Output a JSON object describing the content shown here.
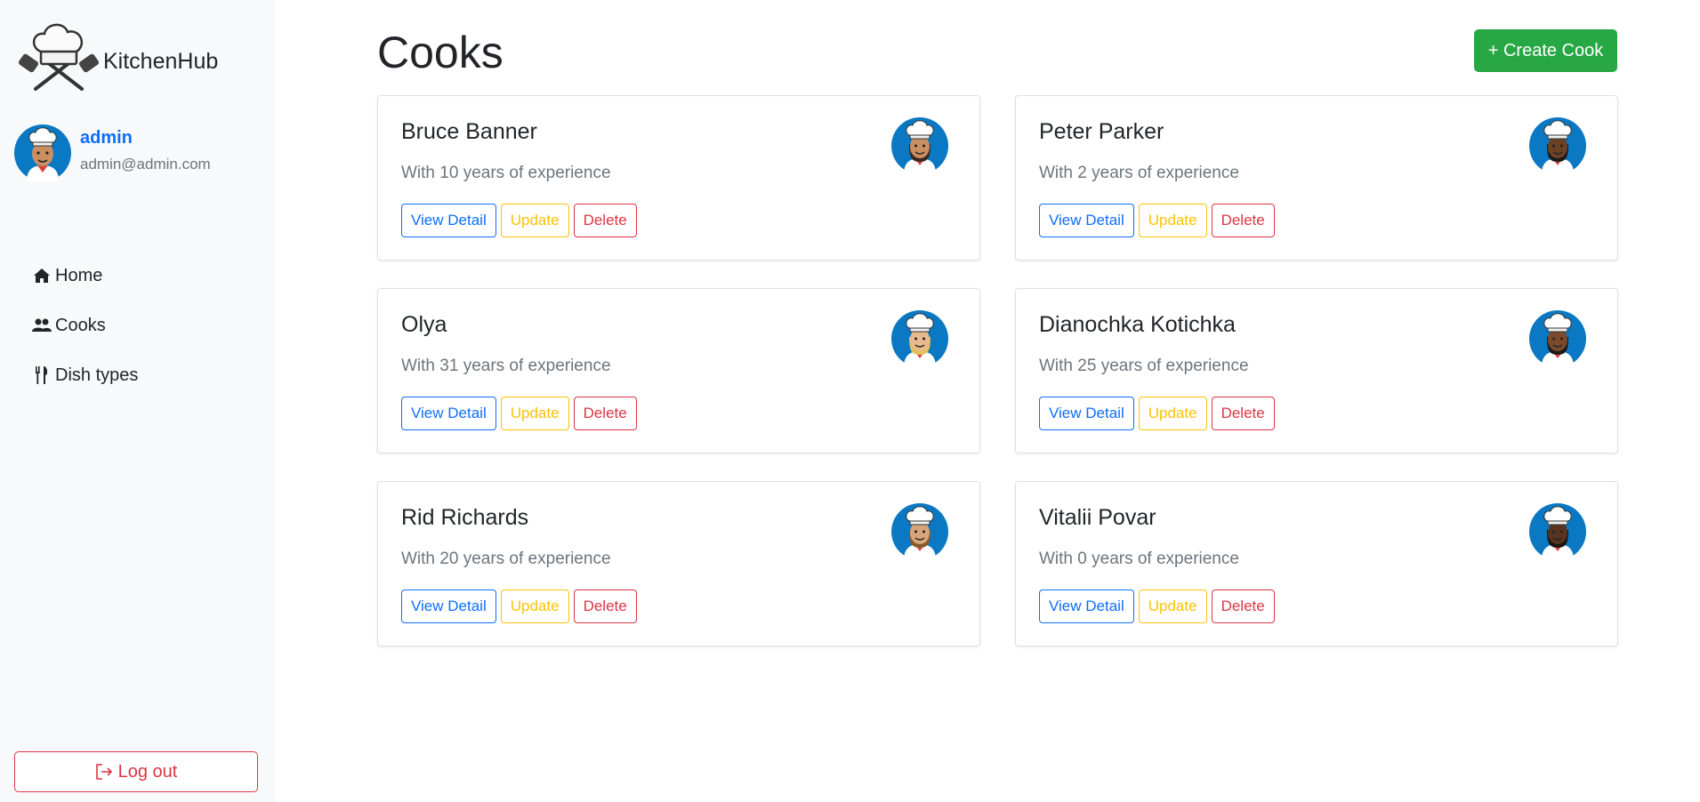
{
  "app": {
    "name": "KitchenHub"
  },
  "user": {
    "name": "admin",
    "email": "admin@admin.com"
  },
  "nav": {
    "items": [
      {
        "label": "Home",
        "icon": "home-icon"
      },
      {
        "label": "Cooks",
        "icon": "users-icon"
      },
      {
        "label": "Dish types",
        "icon": "utensils-icon"
      }
    ]
  },
  "logout_label": "Log out",
  "page": {
    "title": "Cooks",
    "create_label": "+ Create Cook"
  },
  "card_actions": {
    "view": "View Detail",
    "update": "Update",
    "delete": "Delete"
  },
  "cooks": [
    {
      "name": "Bruce Banner",
      "experience": "With 10 years of experience",
      "skin": "#c98f62",
      "hair": "#3a2a1e"
    },
    {
      "name": "Peter Parker",
      "experience": "With 2 years of experience",
      "skin": "#6b4226",
      "hair": "#1e1a18"
    },
    {
      "name": "Olya",
      "experience": "With 31 years of experience",
      "skin": "#e8b98d",
      "hair": "#e6c15a"
    },
    {
      "name": "Dianochka Kotichka",
      "experience": "With 25 years of experience",
      "skin": "#7a4a2b",
      "hair": "#1f1a17"
    },
    {
      "name": "Rid Richards",
      "experience": "With 20 years of experience",
      "skin": "#d8a57a",
      "hair": "#8a5a2b"
    },
    {
      "name": "Vitalii Povar",
      "experience": "With 0 years of experience",
      "skin": "#5a3420",
      "hair": "#1c1612"
    }
  ],
  "colors": {
    "primary": "#0d6efd",
    "success": "#28a745",
    "warning": "#ffc107",
    "danger": "#dc3545",
    "muted": "#6c757d",
    "avatar_bg": "#0a78c2"
  }
}
